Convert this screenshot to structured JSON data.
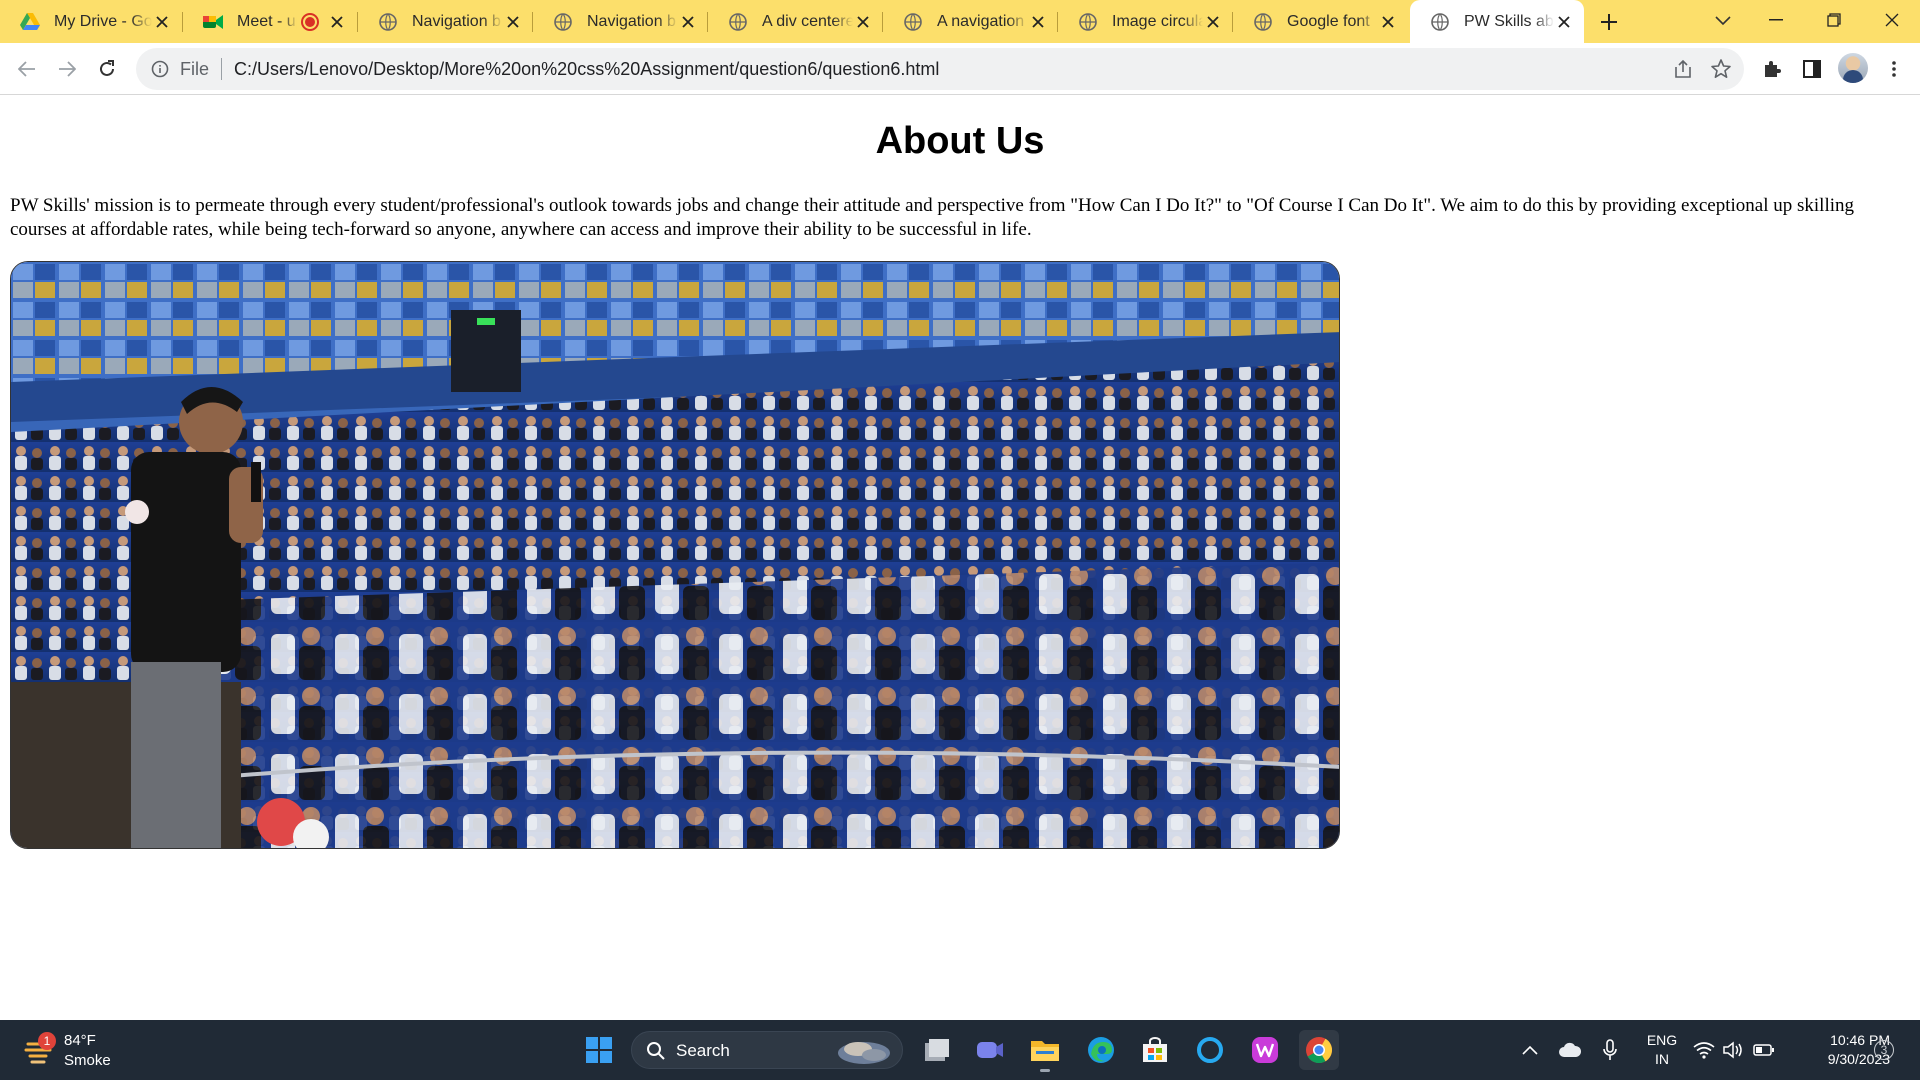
{
  "browser": {
    "tabs": [
      {
        "title": "My Drive - Go",
        "icon": "google-drive-icon"
      },
      {
        "title": "Meet - up",
        "icon": "google-meet-icon",
        "recording": true
      },
      {
        "title": "Navigation b",
        "icon": "globe-icon"
      },
      {
        "title": "Navigation b",
        "icon": "globe-icon"
      },
      {
        "title": "A div centere",
        "icon": "globe-icon"
      },
      {
        "title": "A navigation",
        "icon": "globe-icon"
      },
      {
        "title": "Image circula",
        "icon": "globe-icon"
      },
      {
        "title": "Google font",
        "icon": "globe-icon"
      },
      {
        "title": "PW Skills abo",
        "icon": "globe-icon",
        "active": true
      }
    ],
    "omnibox": {
      "scheme": "File",
      "url": "C:/Users/Lenovo/Desktop/More%20on%20css%20Assignment/question6/question6.html"
    },
    "colors": {
      "tabstrip": "#fcdf6b",
      "active_tab": "#ffffff"
    }
  },
  "page": {
    "heading": "About Us",
    "paragraph": "PW Skills' mission is to permeate through every student/professional's outlook towards jobs and change their attitude and perspective from \"How Can I Do It?\" to \"Of Course I Can Do It\". We aim to do this by providing exceptional up skilling courses at affordable rates, while being tech-forward so anyone, anywhere can access and improve their ability to be successful in life.",
    "image_subject": "auditorium-audience-photo"
  },
  "taskbar": {
    "weather": {
      "temp": "84°F",
      "condition": "Smoke",
      "badge": "1"
    },
    "search_label": "Search",
    "apps": [
      "start-icon",
      "file-explorer-dark-icon",
      "teams-icon",
      "file-explorer-icon",
      "edge-icon",
      "store-icon",
      "cortana-icon",
      "wps-icon",
      "chrome-icon"
    ],
    "language": {
      "line1": "ENG",
      "line2": "IN"
    },
    "clock": {
      "time": "10:46 PM",
      "date": "9/30/2023"
    },
    "notifications": "3"
  }
}
